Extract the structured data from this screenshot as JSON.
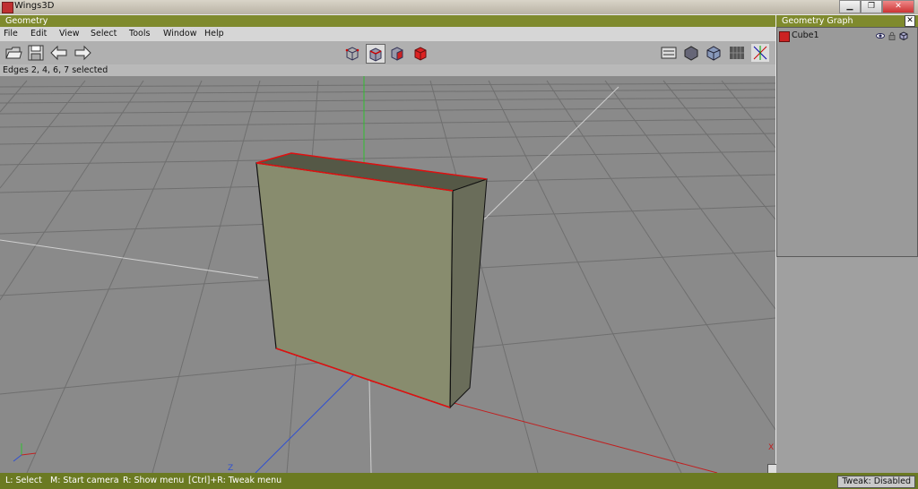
{
  "window": {
    "title": "Wings3D"
  },
  "geometry_window": {
    "title": "Geometry"
  },
  "menu": [
    "File",
    "Edit",
    "View",
    "Select",
    "Tools",
    "Window",
    "Help"
  ],
  "status_line": "Edges 2, 4, 6, 7 selected",
  "viewport_labels": {
    "axis_z": "Z",
    "axis_x": "X"
  },
  "geometry_graph": {
    "title": "Geometry Graph",
    "objects": [
      {
        "name": "Cube1"
      }
    ]
  },
  "bottom_hints": [
    "L: Select",
    "M: Start camera",
    "R: Show menu",
    "[Ctrl]+R: Tweak menu"
  ],
  "tweak_status": "Tweak: Disabled",
  "colors": {
    "header_green": "#7f8a2d",
    "bottom_green": "#6b7a22",
    "selection_red": "#e01010",
    "cube_face": "#888c6e",
    "viewport_bg": "#8a8a8a"
  }
}
